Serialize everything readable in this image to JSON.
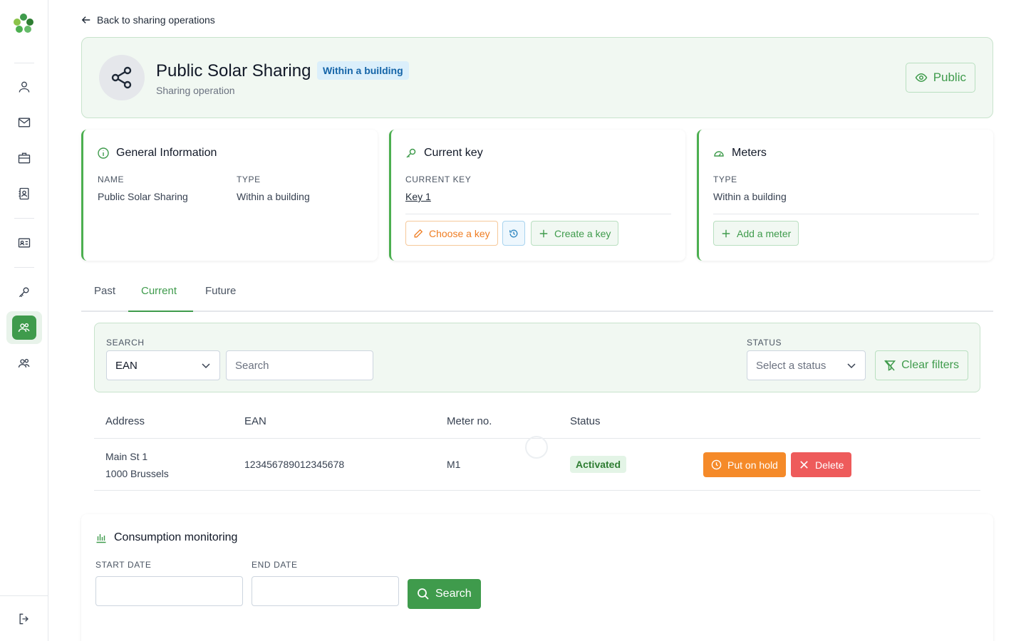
{
  "nav": {
    "back_label": "Back to sharing operations",
    "icons": [
      "user-icon",
      "mail-icon",
      "briefcase-icon",
      "contacts-icon",
      "id-card-icon",
      "key-icon",
      "sharing-group-icon",
      "users-icon",
      "logout-icon"
    ]
  },
  "header": {
    "title": "Public Solar Sharing",
    "badge": "Within a building",
    "subtitle": "Sharing operation",
    "visibility_label": "Public"
  },
  "general_info": {
    "title": "General Information",
    "name_label": "NAME",
    "name_value": "Public Solar Sharing",
    "type_label": "TYPE",
    "type_value": "Within a building"
  },
  "current_key": {
    "title": "Current key",
    "label": "CURRENT KEY",
    "value": "Key 1",
    "choose_label": "Choose a key",
    "create_label": "Create a key"
  },
  "meters": {
    "title": "Meters",
    "type_label": "TYPE",
    "type_value": "Within a building",
    "add_label": "Add a meter"
  },
  "tabs": [
    {
      "label": "Past"
    },
    {
      "label": "Current"
    },
    {
      "label": "Future"
    }
  ],
  "filters": {
    "search_label": "SEARCH",
    "search_field": "EAN",
    "search_placeholder": "Search",
    "status_label": "STATUS",
    "status_placeholder": "Select a status",
    "clear_label": "Clear filters"
  },
  "table": {
    "columns": [
      "Address",
      "EAN",
      "Meter no.",
      "Status"
    ],
    "rows": [
      {
        "address_line1": "Main St 1",
        "address_line2": "1000 Brussels",
        "ean": "123456789012345678",
        "meter_no": "M1",
        "status": "Activated",
        "hold_label": "Put on hold",
        "delete_label": "Delete"
      }
    ]
  },
  "consumption": {
    "title": "Consumption monitoring",
    "start_label": "START DATE",
    "end_label": "END DATE",
    "search_label": "Search"
  },
  "colors": {
    "brand_green": "#3f9b4c",
    "orange": "#f58a29",
    "red": "#ee5b5b",
    "blue_badge": "#1565a8"
  }
}
